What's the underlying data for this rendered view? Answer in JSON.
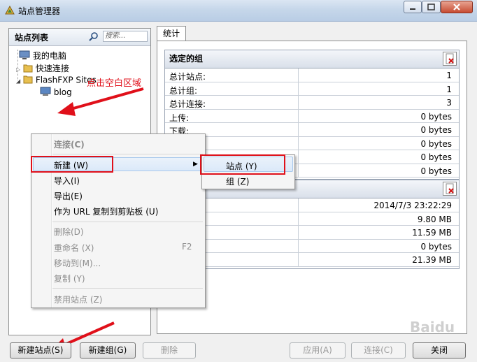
{
  "window": {
    "title": "站点管理器"
  },
  "site_list": {
    "title": "站点列表",
    "search_placeholder": "搜索...",
    "tree": [
      "我的电脑",
      "快速连接",
      "FlashFXP Sites",
      "blog"
    ]
  },
  "annotation": "点击空白区域",
  "tabs": [
    "统计"
  ],
  "selected_group": {
    "title": "选定的组",
    "rows": [
      {
        "label": "总计站点:",
        "value": "1"
      },
      {
        "label": "总计组:",
        "value": "1"
      },
      {
        "label": "总计连接:",
        "value": "3"
      },
      {
        "label": "上传:",
        "value": "0 bytes"
      },
      {
        "label": "下载:",
        "value": "0 bytes"
      },
      {
        "label": "",
        "value": "0 bytes"
      },
      {
        "label": "",
        "value": "0 bytes"
      },
      {
        "label": "",
        "value": "0 bytes"
      }
    ]
  },
  "second_group": {
    "rows": [
      {
        "value": "2014/7/3 23:22:29"
      },
      {
        "value": "9.80 MB"
      },
      {
        "value": "11.59 MB"
      },
      {
        "value": "0 bytes"
      },
      {
        "value": "21.39 MB"
      }
    ]
  },
  "context_menu": {
    "connect": "连接(C)",
    "new": "新建 (W)",
    "import": "导入(I)",
    "export": "导出(E)",
    "copy_url": "作为 URL 复制到剪贴板 (U)",
    "delete": "删除(D)",
    "rename": "重命名 (X)",
    "rename_key": "F2",
    "move": "移动到(M)...",
    "copy": "复制 (Y)",
    "disable": "禁用站点 (Z)"
  },
  "submenu": {
    "site": "站点 (Y)",
    "group": "组 (Z)"
  },
  "buttons": {
    "new_site": "新建站点(S)",
    "new_group": "新建组(G)",
    "delete": "删除",
    "apply": "应用(A)",
    "connect": "连接(C)",
    "close": "关闭"
  },
  "watermark": "Baidu"
}
